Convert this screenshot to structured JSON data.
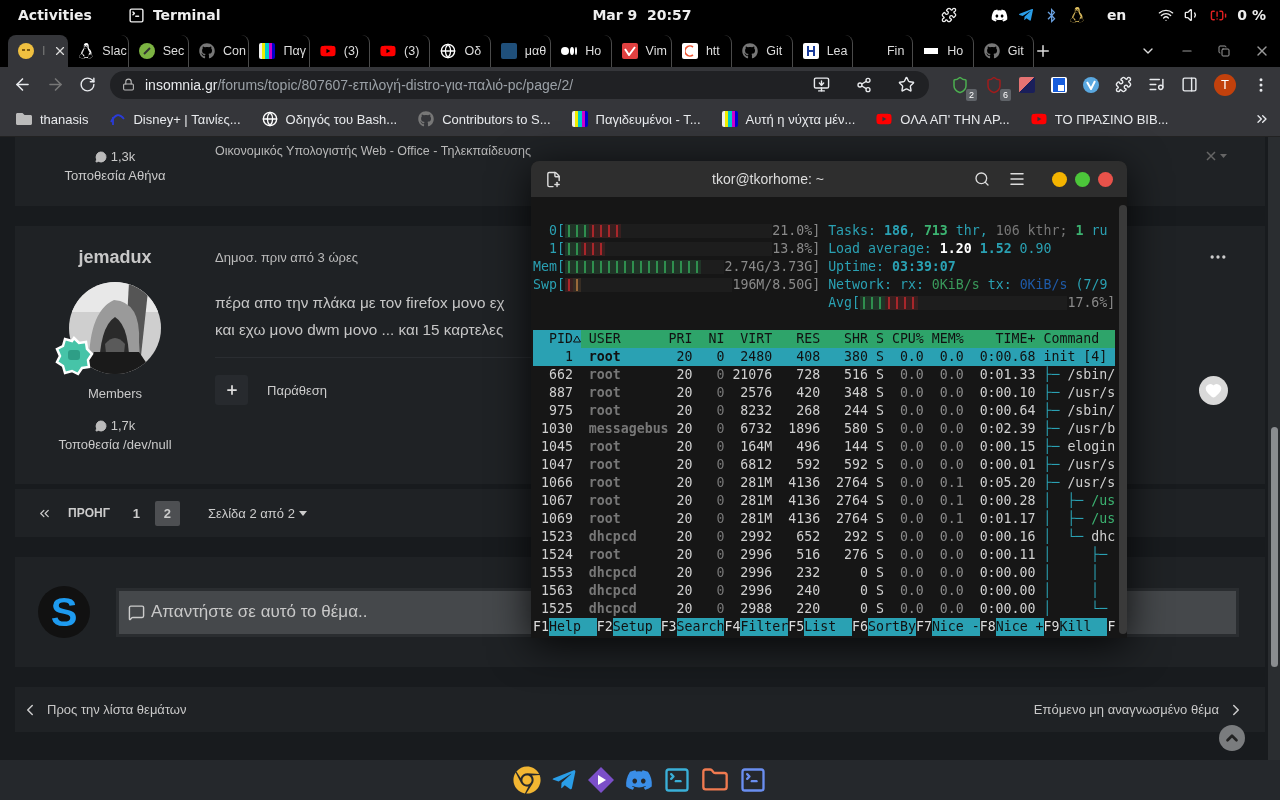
{
  "top_bar": {
    "activities": "Activities",
    "app": "Terminal",
    "date": "Mar 9",
    "time": "20:57",
    "keyboard": "en",
    "battery": "0 %"
  },
  "tabs": [
    {
      "label": "I",
      "selected": true
    },
    {
      "label": "Slac",
      "selected": false
    },
    {
      "label": "Sec",
      "selected": false
    },
    {
      "label": "Con",
      "selected": false
    },
    {
      "label": "Παγ",
      "selected": false
    },
    {
      "label": "(3)",
      "selected": false
    },
    {
      "label": "(3)",
      "selected": false
    },
    {
      "label": "Οδ",
      "selected": false
    },
    {
      "label": "μαθ",
      "selected": false
    },
    {
      "label": "Ho",
      "selected": false
    },
    {
      "label": "Vim",
      "selected": false
    },
    {
      "label": "htt",
      "selected": false
    },
    {
      "label": "Git",
      "selected": false
    },
    {
      "label": "Lea",
      "selected": false
    },
    {
      "label": "Fin",
      "selected": false
    },
    {
      "label": "Ho",
      "selected": false
    },
    {
      "label": "Git",
      "selected": false
    }
  ],
  "address_bar": {
    "host": "insomnia.gr",
    "path": "/forums/topic/807607-επιλογή-distro-για-παλιό-pc/page/2/"
  },
  "toolbar": {
    "badges": [
      "2",
      "6"
    ],
    "profile": "T"
  },
  "bookmarks": [
    {
      "label": "thanasis"
    },
    {
      "label": "Disney+ | Ταινίες..."
    },
    {
      "label": "Οδηγός του Bash..."
    },
    {
      "label": "Contributors to S..."
    },
    {
      "label": "Παγιδευμένοι - Τ..."
    },
    {
      "label": "Αυτή η νύχτα μέν..."
    },
    {
      "label": "ΟΛΑ ΑΠ' ΤΗΝ ΑΡ..."
    },
    {
      "label": "ΤΟ ΠΡΑΣΙΝΟ ΒΙΒ..."
    }
  ],
  "page": {
    "prev_post": {
      "posts": "1,3k",
      "location": "Τοποθεσία Αθήνα",
      "signature": "Οικονομικός Υπολογιστής Web - Office - Τηλεκπαίδευσης"
    },
    "post": {
      "author": "jemadux",
      "group": "Members",
      "posts": "1,7k",
      "location": "Τοποθεσία /dev/null",
      "date": "Δημοσ. πριν από 3 ώρες",
      "lines": [
        "πέρα απο την πλάκα με τον firefox μονο εχ",
        "και εχω μονο dwm μονο ... και 15 καρτελες"
      ],
      "quote": "Παράθεση"
    },
    "pagination": {
      "prev": "ΠΡΟΗΓ",
      "pages": [
        {
          "label": "1",
          "selected": false
        },
        {
          "label": "2",
          "selected": true
        }
      ],
      "summary": "Σελίδα 2 από 2"
    },
    "reply": {
      "avatar": "S",
      "placeholder": "Απαντήστε σε αυτό το θέμα.."
    },
    "nav": {
      "back": "Προς την λίστα θεμάτων",
      "next": "Επόμενο μη αναγνωσμένο θέμα"
    }
  },
  "terminal": {
    "title": "tkor@tkorhome: ~",
    "meters": [
      {
        "label": "0[",
        "segments": [
          {
            "kind": "user",
            "level": 0.115
          },
          {
            "kind": "system",
            "level": 0.154
          }
        ],
        "reading": "21.0%]"
      },
      {
        "label": "1[",
        "segments": [
          {
            "kind": "user",
            "level": 0.077
          },
          {
            "kind": "system",
            "level": 0.115
          }
        ],
        "reading": "13.8%]"
      },
      {
        "label": "Mem[",
        "segments": [
          {
            "kind": "user",
            "level": 0.85
          }
        ],
        "reading": "2.74G/3.73G]"
      },
      {
        "label": "Swp[",
        "segments": [
          {
            "kind": "system",
            "level": 0.048
          },
          {
            "kind": "cache",
            "level": 0.048
          }
        ],
        "reading": "196M/8.50G]"
      }
    ],
    "info": [
      {
        "parts": [
          {
            "text": "Tasks: ",
            "kind": "label"
          },
          {
            "text": "186",
            "kind": "value"
          },
          {
            "text": ", ",
            "kind": "label"
          },
          {
            "text": "713",
            "kind": "thread"
          },
          {
            "text": " thr, ",
            "kind": "label"
          },
          {
            "text": "106 kthr; ",
            "kind": "dim"
          },
          {
            "text": "1",
            "kind": "thread"
          },
          {
            "text": " ru",
            "kind": "label"
          }
        ]
      },
      {
        "parts": [
          {
            "text": "Load average: ",
            "kind": "label"
          },
          {
            "text": "1.20",
            "kind": "bright"
          },
          {
            "text": " 1.52",
            "kind": "value"
          },
          {
            "text": " 0.90",
            "kind": "label"
          }
        ]
      },
      {
        "parts": [
          {
            "text": "Uptime: ",
            "kind": "label"
          },
          {
            "text": "03:39:07",
            "kind": "value"
          }
        ]
      },
      {
        "parts": [
          {
            "text": "Network: rx: ",
            "kind": "label"
          },
          {
            "text": "0KiB/s",
            "kind": "rx"
          },
          {
            "text": " tx: ",
            "kind": "label"
          },
          {
            "text": "0KiB/s",
            "kind": "tx"
          },
          {
            "text": " (7/9",
            "kind": "label"
          }
        ]
      }
    ],
    "avg": {
      "label": "Avg[",
      "segments": [
        {
          "kind": "user",
          "level": 0.12
        },
        {
          "kind": "system",
          "level": 0.16
        }
      ],
      "reading": "17.6%]"
    },
    "columns": [
      {
        "label": "PID",
        "sorted": true
      },
      {
        "label": "USER",
        "sorted": false
      },
      {
        "label": "PRI",
        "sorted": false
      },
      {
        "label": "NI",
        "sorted": false
      },
      {
        "label": "VIRT",
        "sorted": false
      },
      {
        "label": "RES",
        "sorted": false
      },
      {
        "label": "SHR",
        "sorted": false
      },
      {
        "label": "S",
        "sorted": false
      },
      {
        "label": "CPU%",
        "sorted": false
      },
      {
        "label": "MEM%",
        "sorted": false
      },
      {
        "label": "TIME+",
        "sorted": false
      },
      {
        "label": "Command",
        "sorted": false
      }
    ],
    "rows": [
      {
        "pid": "1",
        "user": "root",
        "pri": "20",
        "ni": "0",
        "virt": "2480",
        "res": "408",
        "shr": "380",
        "state": "S",
        "cpu": "0.0",
        "mem": "0.0",
        "time": "0:00.68",
        "command": "init [4]",
        "selected": true,
        "thread": false
      },
      {
        "pid": "662",
        "user": "root",
        "pri": "20",
        "ni": "0",
        "virt": "21076",
        "res": "728",
        "shr": "516",
        "state": "S",
        "cpu": "0.0",
        "mem": "0.0",
        "time": "0:01.33",
        "tree": "├─ ",
        "command": "/sbin/",
        "selected": false,
        "thread": false
      },
      {
        "pid": "887",
        "user": "root",
        "pri": "20",
        "ni": "0",
        "virt": "2576",
        "res": "420",
        "shr": "348",
        "state": "S",
        "cpu": "0.0",
        "mem": "0.0",
        "time": "0:00.10",
        "tree": "├─ ",
        "command": "/usr/s",
        "selected": false,
        "thread": false
      },
      {
        "pid": "975",
        "user": "root",
        "pri": "20",
        "ni": "0",
        "virt": "8232",
        "res": "268",
        "shr": "244",
        "state": "S",
        "cpu": "0.0",
        "mem": "0.0",
        "time": "0:00.64",
        "tree": "├─ ",
        "command": "/sbin/",
        "selected": false,
        "thread": false
      },
      {
        "pid": "1030",
        "user": "messagebus",
        "pri": "20",
        "ni": "0",
        "virt": "6732",
        "res": "1896",
        "shr": "580",
        "state": "S",
        "cpu": "0.0",
        "mem": "0.0",
        "time": "0:02.39",
        "tree": "├─ ",
        "command": "/usr/b",
        "selected": false,
        "thread": false
      },
      {
        "pid": "1045",
        "user": "root",
        "pri": "20",
        "ni": "0",
        "virt": "164M",
        "res": "496",
        "shr": "144",
        "state": "S",
        "cpu": "0.0",
        "mem": "0.0",
        "time": "0:00.15",
        "tree": "├─ ",
        "command": "elogin",
        "selected": false,
        "thread": false
      },
      {
        "pid": "1047",
        "user": "root",
        "pri": "20",
        "ni": "0",
        "virt": "6812",
        "res": "592",
        "shr": "592",
        "state": "S",
        "cpu": "0.0",
        "mem": "0.0",
        "time": "0:00.01",
        "tree": "├─ ",
        "command": "/usr/s",
        "selected": false,
        "thread": false
      },
      {
        "pid": "1066",
        "user": "root",
        "pri": "20",
        "ni": "0",
        "virt": "281M",
        "res": "4136",
        "shr": "2764",
        "state": "S",
        "cpu": "0.0",
        "mem": "0.1",
        "time": "0:05.20",
        "tree": "├─ ",
        "command": "/usr/s",
        "selected": false,
        "thread": false
      },
      {
        "pid": "1067",
        "user": "root",
        "pri": "20",
        "ni": "0",
        "virt": "281M",
        "res": "4136",
        "shr": "2764",
        "state": "S",
        "cpu": "0.0",
        "mem": "0.1",
        "time": "0:00.28",
        "tree": "│  ├─ ",
        "command": "/us",
        "selected": false,
        "thread": true
      },
      {
        "pid": "1069",
        "user": "root",
        "pri": "20",
        "ni": "0",
        "virt": "281M",
        "res": "4136",
        "shr": "2764",
        "state": "S",
        "cpu": "0.0",
        "mem": "0.1",
        "time": "0:01.17",
        "tree": "│  ├─ ",
        "command": "/us",
        "selected": false,
        "thread": true
      },
      {
        "pid": "1523",
        "user": "dhcpcd",
        "pri": "20",
        "ni": "0",
        "virt": "2992",
        "res": "652",
        "shr": "292",
        "state": "S",
        "cpu": "0.0",
        "mem": "0.0",
        "time": "0:00.16",
        "tree": "│  └─ ",
        "command": "dhc",
        "selected": false,
        "thread": false
      },
      {
        "pid": "1524",
        "user": "root",
        "pri": "20",
        "ni": "0",
        "virt": "2996",
        "res": "516",
        "shr": "276",
        "state": "S",
        "cpu": "0.0",
        "mem": "0.0",
        "time": "0:00.11",
        "tree": "│     ├─",
        "selected": false
      },
      {
        "pid": "1553",
        "user": "dhcpcd",
        "pri": "20",
        "ni": "0",
        "virt": "2996",
        "res": "232",
        "shr": "0",
        "state": "S",
        "cpu": "0.0",
        "mem": "0.0",
        "time": "0:00.00",
        "tree": "│     │",
        "selected": false
      },
      {
        "pid": "1563",
        "user": "dhcpcd",
        "pri": "20",
        "ni": "0",
        "virt": "2996",
        "res": "240",
        "shr": "0",
        "state": "S",
        "cpu": "0.0",
        "mem": "0.0",
        "time": "0:00.00",
        "tree": "│     │",
        "selected": false
      },
      {
        "pid": "1525",
        "user": "dhcpcd",
        "pri": "20",
        "ni": "0",
        "virt": "2988",
        "res": "220",
        "shr": "0",
        "state": "S",
        "cpu": "0.0",
        "mem": "0.0",
        "time": "0:00.00",
        "tree": "│     └─",
        "selected": false
      }
    ],
    "function_keys": [
      {
        "key": "F1",
        "label": "Help"
      },
      {
        "key": "F2",
        "label": "Setup"
      },
      {
        "key": "F3",
        "label": "Search"
      },
      {
        "key": "F4",
        "label": "Filter"
      },
      {
        "key": "F5",
        "label": "List"
      },
      {
        "key": "F6",
        "label": "SortBy"
      },
      {
        "key": "F7",
        "label": "Nice -"
      },
      {
        "key": "F8",
        "label": "Nice +"
      },
      {
        "key": "F9",
        "label": "Kill"
      },
      {
        "key": "F"
      }
    ]
  }
}
